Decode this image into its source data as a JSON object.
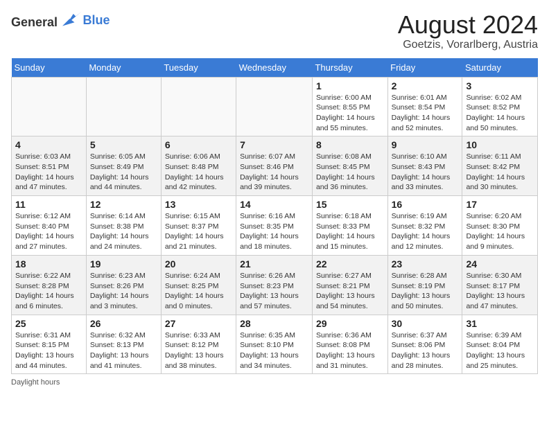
{
  "header": {
    "logo_general": "General",
    "logo_blue": "Blue",
    "month_title": "August 2024",
    "location": "Goetzis, Vorarlberg, Austria"
  },
  "days_of_week": [
    "Sunday",
    "Monday",
    "Tuesday",
    "Wednesday",
    "Thursday",
    "Friday",
    "Saturday"
  ],
  "footer": {
    "daylight_label": "Daylight hours"
  },
  "weeks": [
    [
      {
        "day": "",
        "info": ""
      },
      {
        "day": "",
        "info": ""
      },
      {
        "day": "",
        "info": ""
      },
      {
        "day": "",
        "info": ""
      },
      {
        "day": "1",
        "info": "Sunrise: 6:00 AM\nSunset: 8:55 PM\nDaylight: 14 hours\nand 55 minutes."
      },
      {
        "day": "2",
        "info": "Sunrise: 6:01 AM\nSunset: 8:54 PM\nDaylight: 14 hours\nand 52 minutes."
      },
      {
        "day": "3",
        "info": "Sunrise: 6:02 AM\nSunset: 8:52 PM\nDaylight: 14 hours\nand 50 minutes."
      }
    ],
    [
      {
        "day": "4",
        "info": "Sunrise: 6:03 AM\nSunset: 8:51 PM\nDaylight: 14 hours\nand 47 minutes."
      },
      {
        "day": "5",
        "info": "Sunrise: 6:05 AM\nSunset: 8:49 PM\nDaylight: 14 hours\nand 44 minutes."
      },
      {
        "day": "6",
        "info": "Sunrise: 6:06 AM\nSunset: 8:48 PM\nDaylight: 14 hours\nand 42 minutes."
      },
      {
        "day": "7",
        "info": "Sunrise: 6:07 AM\nSunset: 8:46 PM\nDaylight: 14 hours\nand 39 minutes."
      },
      {
        "day": "8",
        "info": "Sunrise: 6:08 AM\nSunset: 8:45 PM\nDaylight: 14 hours\nand 36 minutes."
      },
      {
        "day": "9",
        "info": "Sunrise: 6:10 AM\nSunset: 8:43 PM\nDaylight: 14 hours\nand 33 minutes."
      },
      {
        "day": "10",
        "info": "Sunrise: 6:11 AM\nSunset: 8:42 PM\nDaylight: 14 hours\nand 30 minutes."
      }
    ],
    [
      {
        "day": "11",
        "info": "Sunrise: 6:12 AM\nSunset: 8:40 PM\nDaylight: 14 hours\nand 27 minutes."
      },
      {
        "day": "12",
        "info": "Sunrise: 6:14 AM\nSunset: 8:38 PM\nDaylight: 14 hours\nand 24 minutes."
      },
      {
        "day": "13",
        "info": "Sunrise: 6:15 AM\nSunset: 8:37 PM\nDaylight: 14 hours\nand 21 minutes."
      },
      {
        "day": "14",
        "info": "Sunrise: 6:16 AM\nSunset: 8:35 PM\nDaylight: 14 hours\nand 18 minutes."
      },
      {
        "day": "15",
        "info": "Sunrise: 6:18 AM\nSunset: 8:33 PM\nDaylight: 14 hours\nand 15 minutes."
      },
      {
        "day": "16",
        "info": "Sunrise: 6:19 AM\nSunset: 8:32 PM\nDaylight: 14 hours\nand 12 minutes."
      },
      {
        "day": "17",
        "info": "Sunrise: 6:20 AM\nSunset: 8:30 PM\nDaylight: 14 hours\nand 9 minutes."
      }
    ],
    [
      {
        "day": "18",
        "info": "Sunrise: 6:22 AM\nSunset: 8:28 PM\nDaylight: 14 hours\nand 6 minutes."
      },
      {
        "day": "19",
        "info": "Sunrise: 6:23 AM\nSunset: 8:26 PM\nDaylight: 14 hours\nand 3 minutes."
      },
      {
        "day": "20",
        "info": "Sunrise: 6:24 AM\nSunset: 8:25 PM\nDaylight: 14 hours\nand 0 minutes."
      },
      {
        "day": "21",
        "info": "Sunrise: 6:26 AM\nSunset: 8:23 PM\nDaylight: 13 hours\nand 57 minutes."
      },
      {
        "day": "22",
        "info": "Sunrise: 6:27 AM\nSunset: 8:21 PM\nDaylight: 13 hours\nand 54 minutes."
      },
      {
        "day": "23",
        "info": "Sunrise: 6:28 AM\nSunset: 8:19 PM\nDaylight: 13 hours\nand 50 minutes."
      },
      {
        "day": "24",
        "info": "Sunrise: 6:30 AM\nSunset: 8:17 PM\nDaylight: 13 hours\nand 47 minutes."
      }
    ],
    [
      {
        "day": "25",
        "info": "Sunrise: 6:31 AM\nSunset: 8:15 PM\nDaylight: 13 hours\nand 44 minutes."
      },
      {
        "day": "26",
        "info": "Sunrise: 6:32 AM\nSunset: 8:13 PM\nDaylight: 13 hours\nand 41 minutes."
      },
      {
        "day": "27",
        "info": "Sunrise: 6:33 AM\nSunset: 8:12 PM\nDaylight: 13 hours\nand 38 minutes."
      },
      {
        "day": "28",
        "info": "Sunrise: 6:35 AM\nSunset: 8:10 PM\nDaylight: 13 hours\nand 34 minutes."
      },
      {
        "day": "29",
        "info": "Sunrise: 6:36 AM\nSunset: 8:08 PM\nDaylight: 13 hours\nand 31 minutes."
      },
      {
        "day": "30",
        "info": "Sunrise: 6:37 AM\nSunset: 8:06 PM\nDaylight: 13 hours\nand 28 minutes."
      },
      {
        "day": "31",
        "info": "Sunrise: 6:39 AM\nSunset: 8:04 PM\nDaylight: 13 hours\nand 25 minutes."
      }
    ]
  ]
}
